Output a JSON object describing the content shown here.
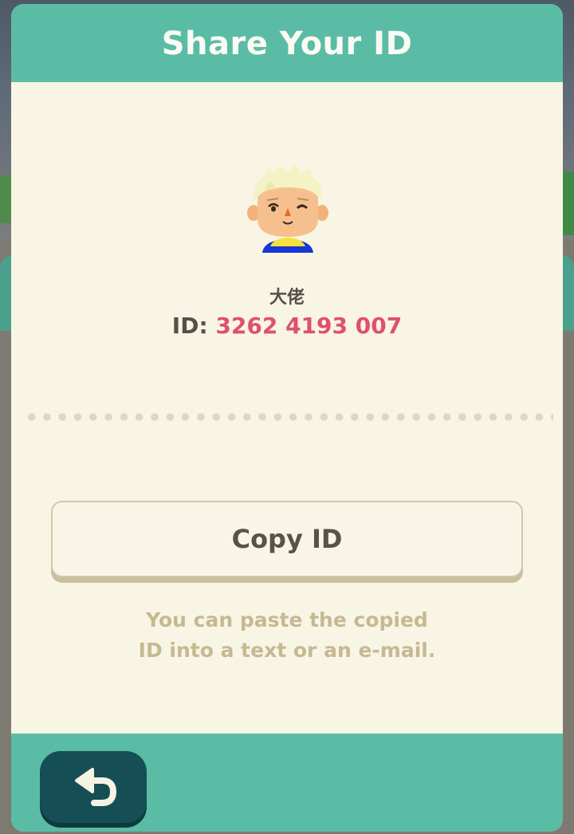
{
  "dialog": {
    "title": "Share Your ID"
  },
  "player": {
    "name": "大佬",
    "id_label": "ID:",
    "id_value": "3262 4193 007",
    "avatar_icon": "player-avatar"
  },
  "actions": {
    "copy_label": "Copy ID",
    "hint_line1": "You can paste the copied",
    "hint_line2": "ID into a text or an e-mail."
  },
  "footer": {
    "back_icon": "back-arrow-icon"
  },
  "colors": {
    "header": "#5bbca6",
    "panel": "#f8f5e5",
    "id_value": "#e0506a",
    "back_button": "#154f55"
  }
}
